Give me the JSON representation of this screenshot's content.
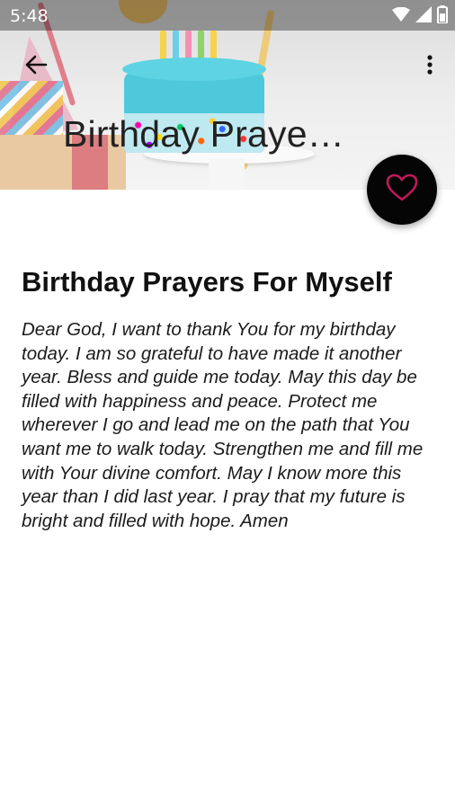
{
  "status_bar": {
    "time": "5:48",
    "icons": [
      "wifi-icon",
      "signal-icon",
      "battery-icon"
    ]
  },
  "header": {
    "collapsed_title": "Birthday Praye…",
    "back_icon": "arrow-left-icon",
    "menu_icon": "more-vert-icon"
  },
  "fab": {
    "icon": "heart-outline-icon",
    "icon_color": "#c2185b",
    "background": "#050505"
  },
  "content": {
    "title": "Birthday Prayers For Myself",
    "body": "Dear God, I want to thank You for my birthday today. I am so grateful to have made it another year. Bless and guide me today. May this day be filled with happiness and peace. Protect me wherever I go and lead me on the path that You want me to walk today. Strengthen me and fill me with Your divine comfort. May I know more this year than I did last year. I pray that my future is bright and filled with hope. Amen"
  }
}
